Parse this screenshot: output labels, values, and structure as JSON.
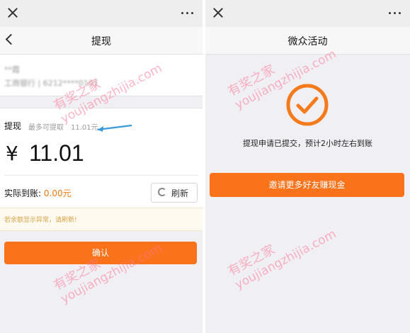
{
  "left": {
    "nav_title": "提现",
    "bank_name": "**霞",
    "bank_account": "工商银行 | 6212****0101",
    "withdraw_label": "提现",
    "max_label": "最多可提取",
    "max_value": "11.01元",
    "currency_symbol": "¥",
    "amount": "11.01",
    "actual_label": "实际到账:",
    "actual_value": "0.00元",
    "refresh_label": "刷新",
    "warning": "若余额显示异常，请刷新!",
    "confirm_label": "确认"
  },
  "right": {
    "nav_title": "微众活动",
    "submitted_text": "提现申请已提交，预计2小时左右到账",
    "invite_label": "邀请更多好友赚现金"
  },
  "watermark": {
    "cn": "有奖之家",
    "en": "youjiangzhijia.com"
  },
  "colors": {
    "accent": "#fa7219",
    "check": "#f47a1c",
    "arrow": "#3a9ad9"
  }
}
